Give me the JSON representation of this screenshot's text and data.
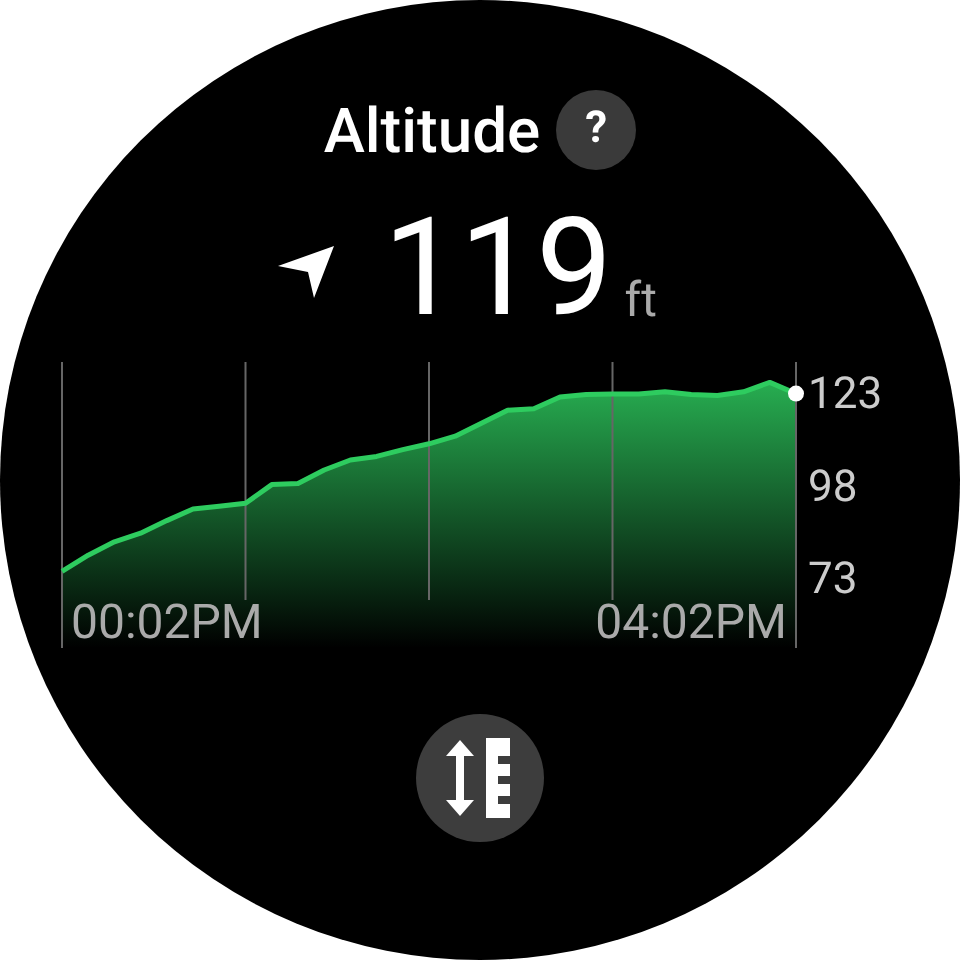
{
  "title": "Altitude",
  "help_button": "?",
  "reading": {
    "value": "119",
    "unit": "ft"
  },
  "chart_data": {
    "type": "area",
    "categories": [
      null,
      null,
      null,
      null,
      "00:02PM",
      null,
      null,
      null,
      null,
      null,
      null,
      null,
      null,
      null,
      null,
      null,
      null,
      null,
      null,
      null,
      null,
      null,
      null,
      null,
      "04:02PM",
      null,
      null,
      null,
      null
    ],
    "grid": true,
    "series": [
      {
        "color": "#2ecc5f",
        "values": [
          74.6,
          79,
          82.6,
          84.9,
          88.3,
          91.4,
          92.2,
          93,
          98,
          98.3,
          101.9,
          104.6,
          105.6,
          107.4,
          109,
          111,
          114.5,
          118,
          118.4,
          121.6,
          122.3,
          122.4,
          122.4,
          123,
          122.2,
          122,
          123,
          125.5,
          122.5
        ]
      }
    ],
    "ylim": [
      54,
      131
    ],
    "yticks": [
      123,
      98,
      73
    ]
  }
}
